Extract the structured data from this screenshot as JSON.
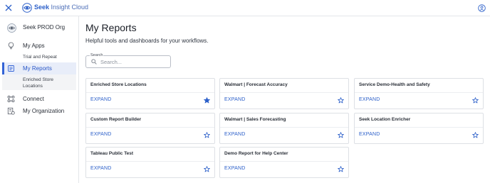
{
  "header": {
    "brand_bold": "Seek",
    "brand_rest": " Insight Cloud"
  },
  "sidebar": {
    "org_name": "Seek PROD Org",
    "items": [
      {
        "label": "My Apps",
        "icon": "lightbulb-icon"
      },
      {
        "label": "Trial and Repeat",
        "icon": ""
      },
      {
        "label": "My Reports",
        "icon": "report-icon"
      },
      {
        "label": "Enriched Store Locations",
        "icon": ""
      },
      {
        "label": "Connect",
        "icon": "connect-icon"
      },
      {
        "label": "My Organization",
        "icon": "organization-icon"
      }
    ]
  },
  "main": {
    "title": "My Reports",
    "subtitle": "Helpful tools and dashboards for your workflows.",
    "search": {
      "label": "Search",
      "placeholder": "Search...",
      "value": ""
    },
    "cards": [
      {
        "title": "Enriched Store Locations",
        "action": "EXPAND",
        "starred": true
      },
      {
        "title": "Walmart | Forecast Accuracy",
        "action": "EXPAND",
        "starred": false
      },
      {
        "title": "Service Demo-Health and Safety",
        "action": "EXPAND",
        "starred": false
      },
      {
        "title": "Custom Report Builder",
        "action": "EXPAND",
        "starred": false
      },
      {
        "title": "Walmart | Sales Forecasting",
        "action": "EXPAND",
        "starred": false
      },
      {
        "title": "Seek Location Enricher",
        "action": "EXPAND",
        "starred": false
      },
      {
        "title": "Tableau Public Test",
        "action": "EXPAND",
        "starred": false
      },
      {
        "title": "Demo Report for Help Center",
        "action": "EXPAND",
        "starred": false
      }
    ]
  },
  "colors": {
    "accent": "#2b5fc9",
    "active_bg": "#e8edf9",
    "active_bar": "#3363d6"
  }
}
